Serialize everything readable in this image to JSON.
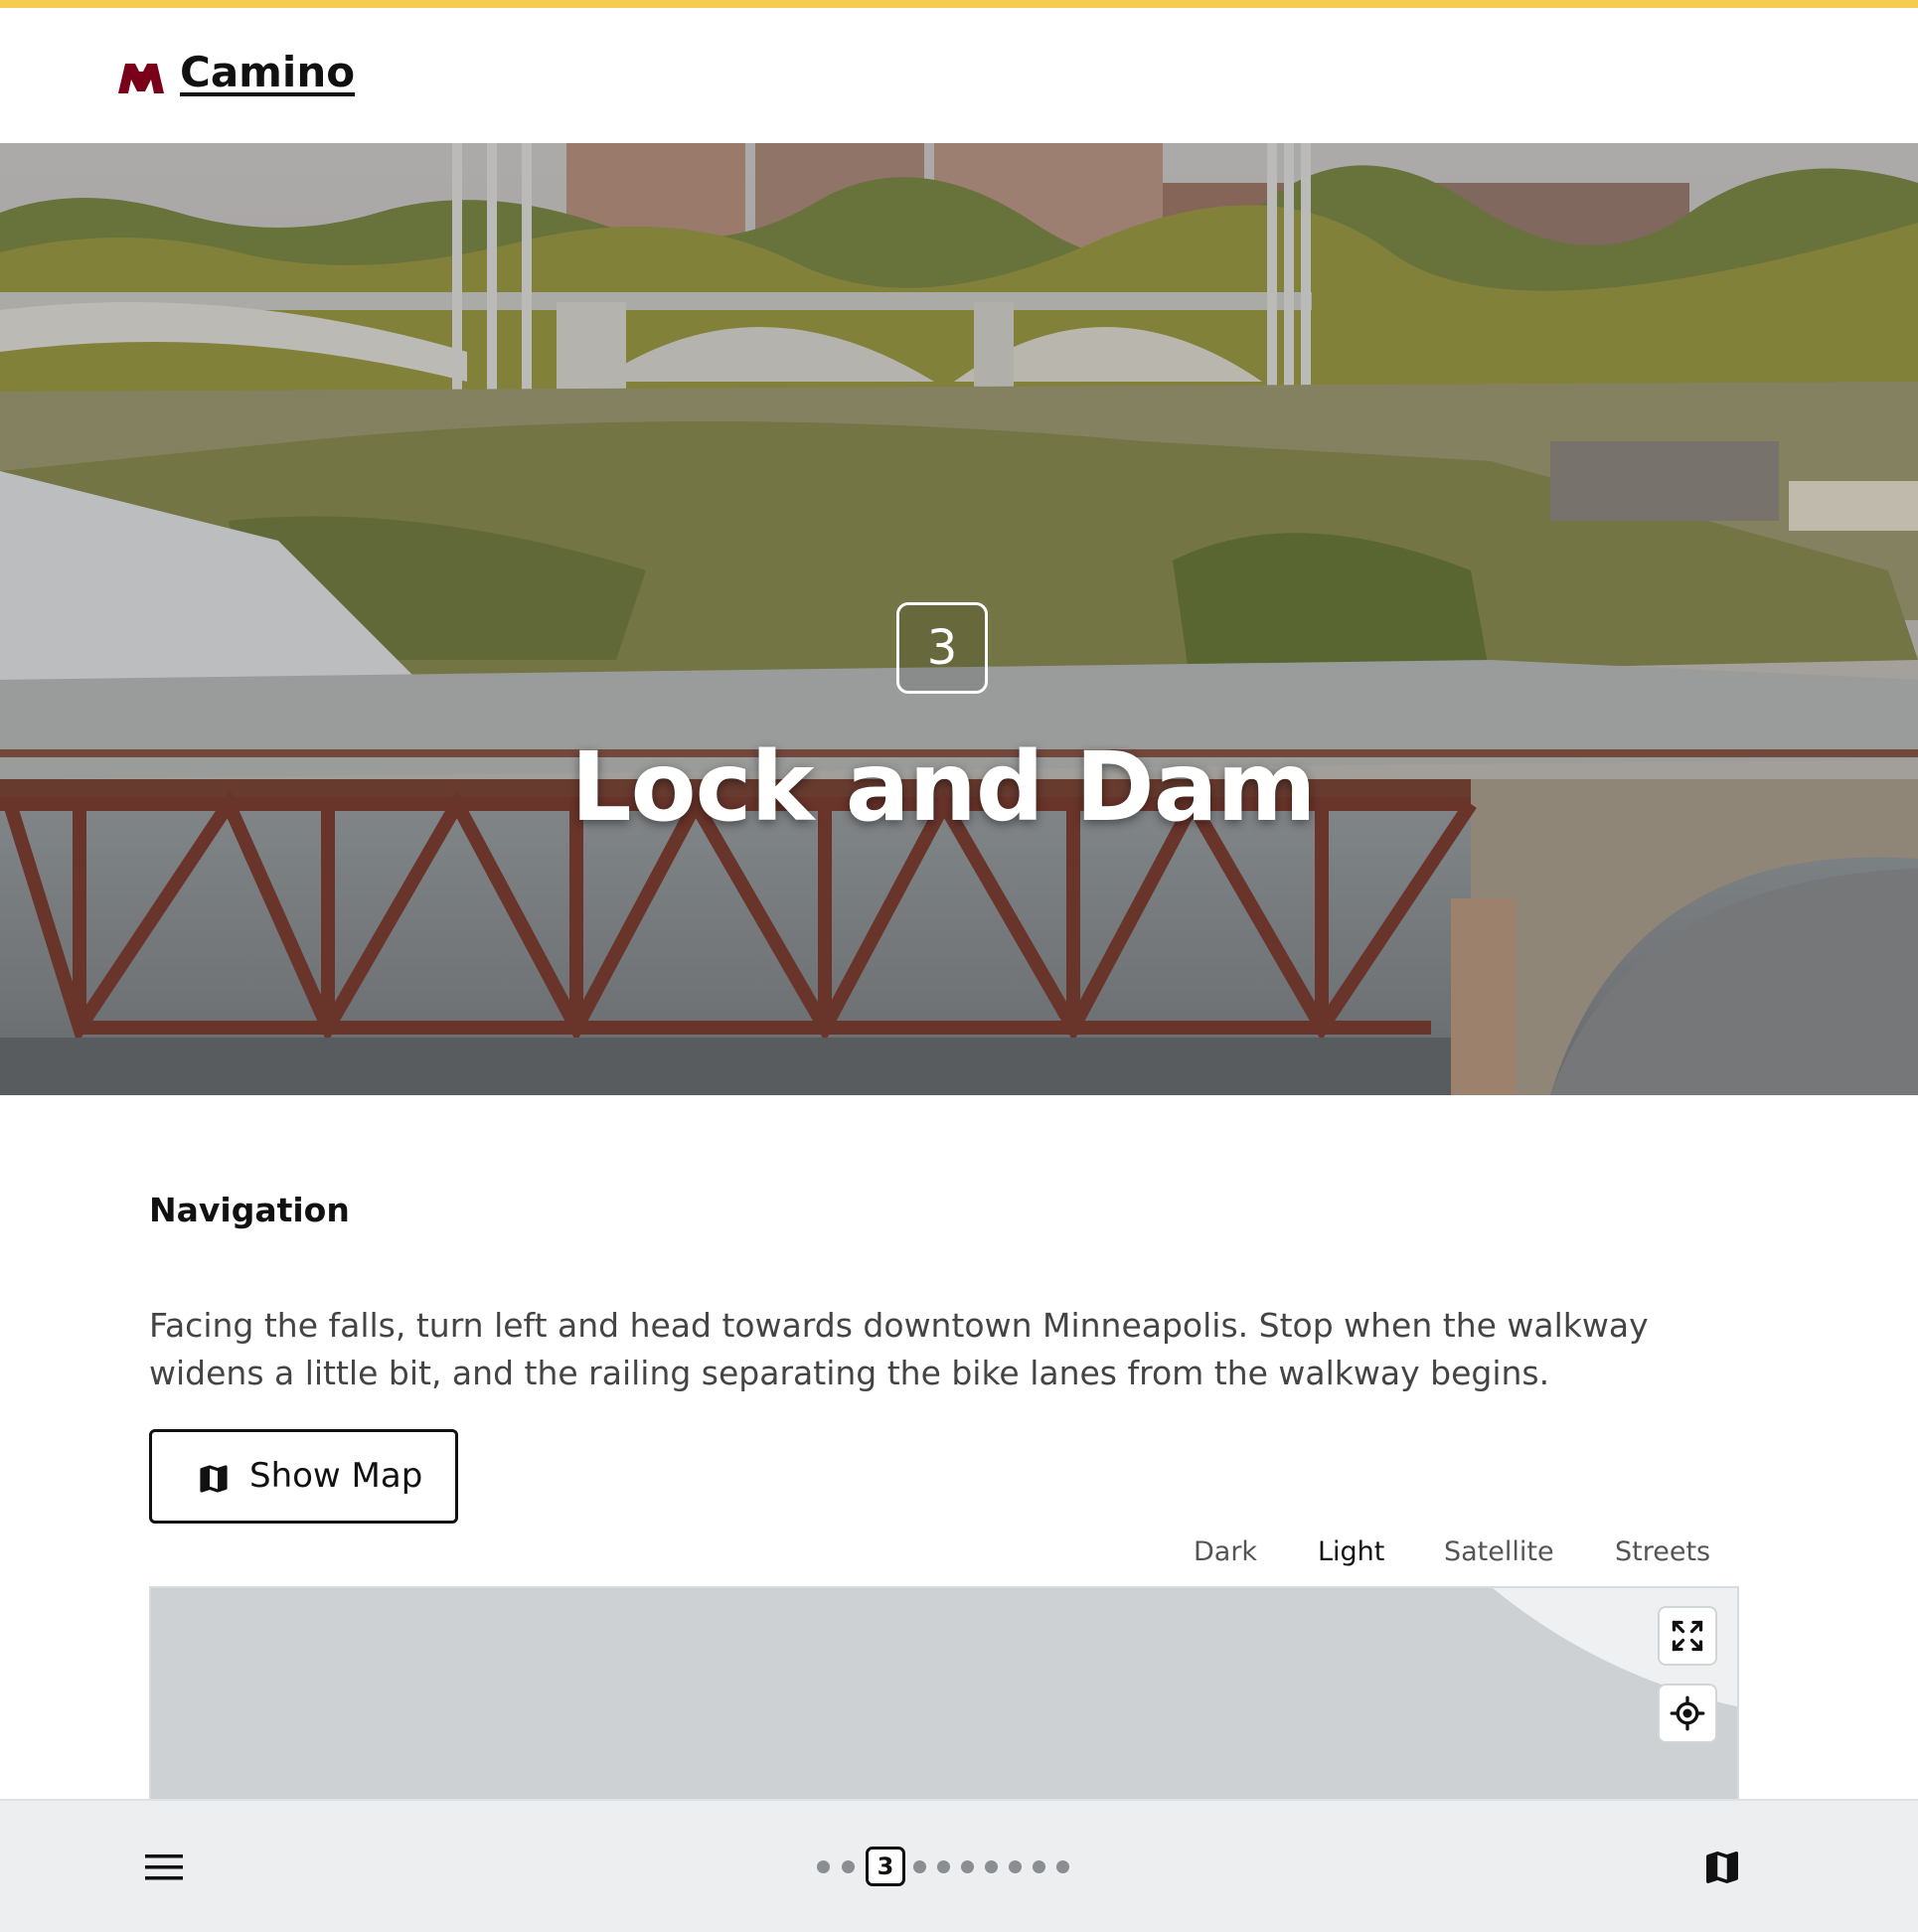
{
  "brand": {
    "name": "Camino"
  },
  "colors": {
    "accent": "#f5cc4d",
    "logo": "#7a0019",
    "text": "#111111",
    "muted": "#444444"
  },
  "hero": {
    "stop_number": "3",
    "title": "Lock and Dam"
  },
  "navigation": {
    "heading": "Navigation",
    "text": "Facing the falls, turn left and head towards downtown Minneapolis. Stop when the walkway widens a little bit, and the railing separating the bike lanes from the walkway begins."
  },
  "show_map_button": {
    "label": "Show Map",
    "icon": "map-icon"
  },
  "map_styles": {
    "selected": "Light",
    "items": [
      {
        "label": "Dark"
      },
      {
        "label": "Light"
      },
      {
        "label": "Satellite"
      },
      {
        "label": "Streets"
      }
    ]
  },
  "map_controls": [
    {
      "icon": "fullscreen-icon"
    },
    {
      "icon": "locate-icon"
    }
  ],
  "bottom_bar": {
    "menu_icon": "hamburger-menu-icon",
    "map_icon": "map-icon",
    "pager": {
      "current": "3",
      "total_stops": 11
    }
  }
}
